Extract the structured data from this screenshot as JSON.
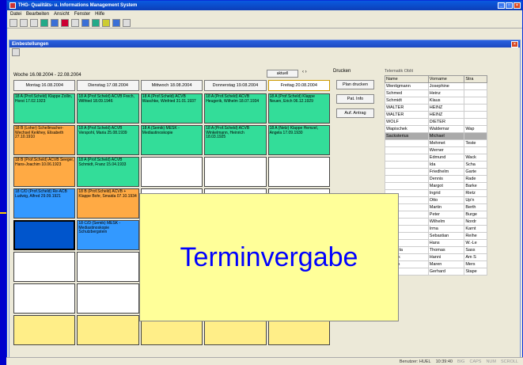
{
  "app_title": "THG- Qualitäts- u. Informations Management System",
  "menu": [
    "Datei",
    "Bearbeiten",
    "Ansicht",
    "Fenster",
    "Hilfe"
  ],
  "inner_title": "Einbestellungen",
  "week_label": "Woche   16.08.2004 - 22.08.2004",
  "aktuell": "aktuell",
  "days": [
    "Montag 16.08.2004",
    "Dienstag 17.08.2004",
    "Mittwoch 18.08.2004",
    "Donnerstag 19.08.2004",
    "Freitag 20.08.2004"
  ],
  "cells": [
    [
      "g",
      "18 A (Prof.Scheld) Klappe Zollin, Horst 17.02.1923"
    ],
    [
      "g",
      "18 A (Prof.Scheld) ACVB Frech, Wilfried 18.09.1946"
    ],
    [
      "g",
      "18 A (Prof.Scheld) ACVB Waschke, Winfried 31.01.1937"
    ],
    [
      "g",
      "18 A (Prof.Scheld) ACVB Heugerik, Wilhelm 18.07.1934"
    ],
    [
      "g",
      "18 A (Prof.Scheld) Klappe Neuen, Erich 06.12.1929"
    ],
    [
      "o",
      "18 B (Loher) Schellmacher-Wechsel Keikhey, Elisabeth 27.10.1910"
    ],
    [
      "g",
      "18 A (Prof.Scheld) ACVB Verspohl, Maria 25.08.1939"
    ],
    [
      "g",
      "18 A (Semik) MESK - Mediastinoskopie"
    ],
    [
      "g",
      "18 A (Prof.Scheld) ACVB Winkelmann, Heinrich 18.03.1925"
    ],
    [
      "g",
      "18 A (Netz) Klappe Hemzel, Angela 17.09.1930"
    ],
    [
      "o",
      "18 B (Prof.Scheld) ACVB Seeger, Hans-Joachim 10.06.1923"
    ],
    [
      "g",
      "18 A (Prof.Scheld) ACVB Schmidt, Franz 15.04.1933"
    ],
    [
      "w",
      ""
    ],
    [
      "w",
      ""
    ],
    [
      "w",
      ""
    ],
    [
      "b",
      "18 C/D (Prof.Scheld) Re-ACB Ludwig, Alfred 29.09.1921"
    ],
    [
      "o",
      "18 B (Prof.Scheld) ACVB + Klappe Bohr, Smaida 07.10.1934"
    ],
    [
      "w",
      ""
    ],
    [
      "w",
      ""
    ],
    [
      "w",
      ""
    ],
    [
      "bs",
      ""
    ],
    [
      "b",
      "18 C/D (Semik) MESK - Mediastinoskopie Schutzbergstein"
    ],
    [
      "w",
      ""
    ],
    [
      "w",
      ""
    ],
    [
      "w",
      ""
    ],
    [
      "w",
      ""
    ],
    [
      "w",
      ""
    ],
    [
      "w",
      ""
    ],
    [
      "w",
      ""
    ],
    [
      "w",
      ""
    ],
    [
      "w",
      ""
    ],
    [
      "w",
      ""
    ],
    [
      "w",
      ""
    ],
    [
      "w",
      ""
    ],
    [
      "w",
      ""
    ],
    [
      "y",
      ""
    ],
    [
      "y",
      ""
    ],
    [
      "y",
      ""
    ],
    [
      "y",
      ""
    ],
    [
      "y",
      ""
    ]
  ],
  "drucken": {
    "label": "Drucken",
    "buttons": [
      "Plan drucken",
      "Pat. Info",
      "Auf. Antrag"
    ]
  },
  "list": {
    "header_tabs": "Telematik  Oblit",
    "columns": [
      "Name",
      "Vorname",
      "Stra"
    ],
    "rows": [
      [
        "Wentigmann",
        "Josephine",
        ""
      ],
      [
        "Schmed",
        "Heinz",
        ""
      ],
      [
        "Schmidt",
        "Klaus",
        ""
      ],
      [
        "WALTER",
        "HEINZ",
        ""
      ],
      [
        "WALTER",
        "HEINZ",
        ""
      ],
      [
        "WOLF",
        "DIETER",
        ""
      ],
      [
        "Wapischek",
        "Waldemar",
        "Wap"
      ],
      [
        "Sacksterius",
        "Michael",
        ""
      ],
      [
        "",
        "Mehmet",
        "Teste"
      ],
      [
        "",
        "Werner",
        ""
      ],
      [
        "",
        "Edmund",
        "Wack"
      ],
      [
        "",
        "Ida",
        "Scha"
      ],
      [
        "",
        "Friedhelm",
        "Garte"
      ],
      [
        "",
        "Dennis",
        "Rade"
      ],
      [
        "",
        "Margot",
        "Barke"
      ],
      [
        "",
        "Ingrid",
        "Rietz"
      ],
      [
        "",
        "Otto",
        "Up'n"
      ],
      [
        "",
        "Martin",
        "Berth"
      ],
      [
        "",
        "Peter",
        "Burge"
      ],
      [
        "",
        "Wilhelm",
        "Nordr"
      ],
      [
        "",
        "Irma",
        "Karnt"
      ],
      [
        "",
        "Sebastian",
        "Reihe"
      ],
      [
        "",
        "Hans",
        "W.-Le"
      ],
      [
        "Waskela",
        "Thomas",
        "Sass"
      ],
      [
        "Ruprak",
        "Hanni",
        "Am S"
      ],
      [
        "Rotens",
        "Maren",
        "Mers"
      ],
      [
        "Mohr",
        "Gerhard",
        "Stape"
      ]
    ]
  },
  "overlay_text": "Terminvergabe",
  "status": {
    "user": "Benutzer: HUEL",
    "time": "10:39:40",
    "flags": [
      "BIG",
      "CAPS",
      "NUM",
      "SCROLL"
    ]
  }
}
